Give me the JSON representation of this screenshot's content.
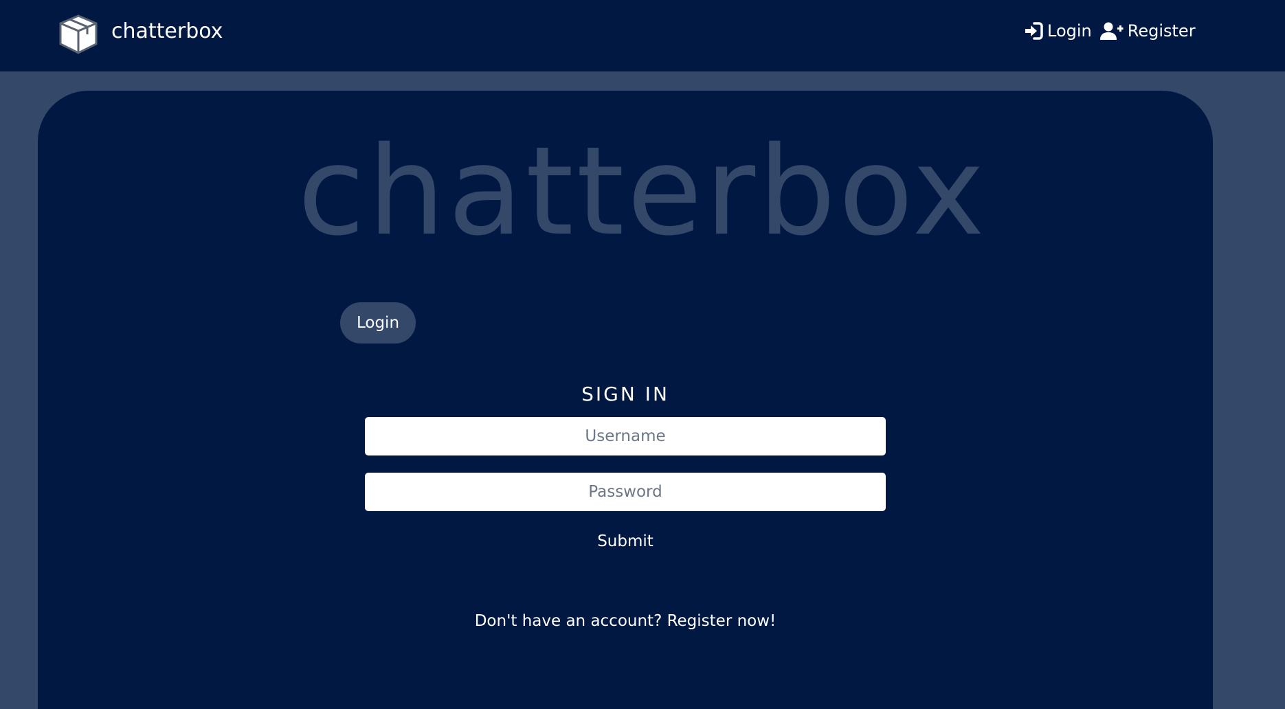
{
  "brand": {
    "name": "chatterbox",
    "logo_icon": "box-icon"
  },
  "nav": {
    "login_label": "Login",
    "login_icon": "sign-in-icon",
    "register_label": "Register",
    "register_icon": "user-plus-icon"
  },
  "hero": {
    "title": "chatterbox"
  },
  "tab": {
    "label": "Login"
  },
  "form": {
    "heading": "SIGN IN",
    "username_placeholder": "Username",
    "password_placeholder": "Password",
    "submit_label": "Submit",
    "register_prompt": "Don't have an account? Register now!"
  },
  "colors": {
    "navy": "#011843",
    "slate": "#34486a",
    "white": "#ffffff"
  }
}
